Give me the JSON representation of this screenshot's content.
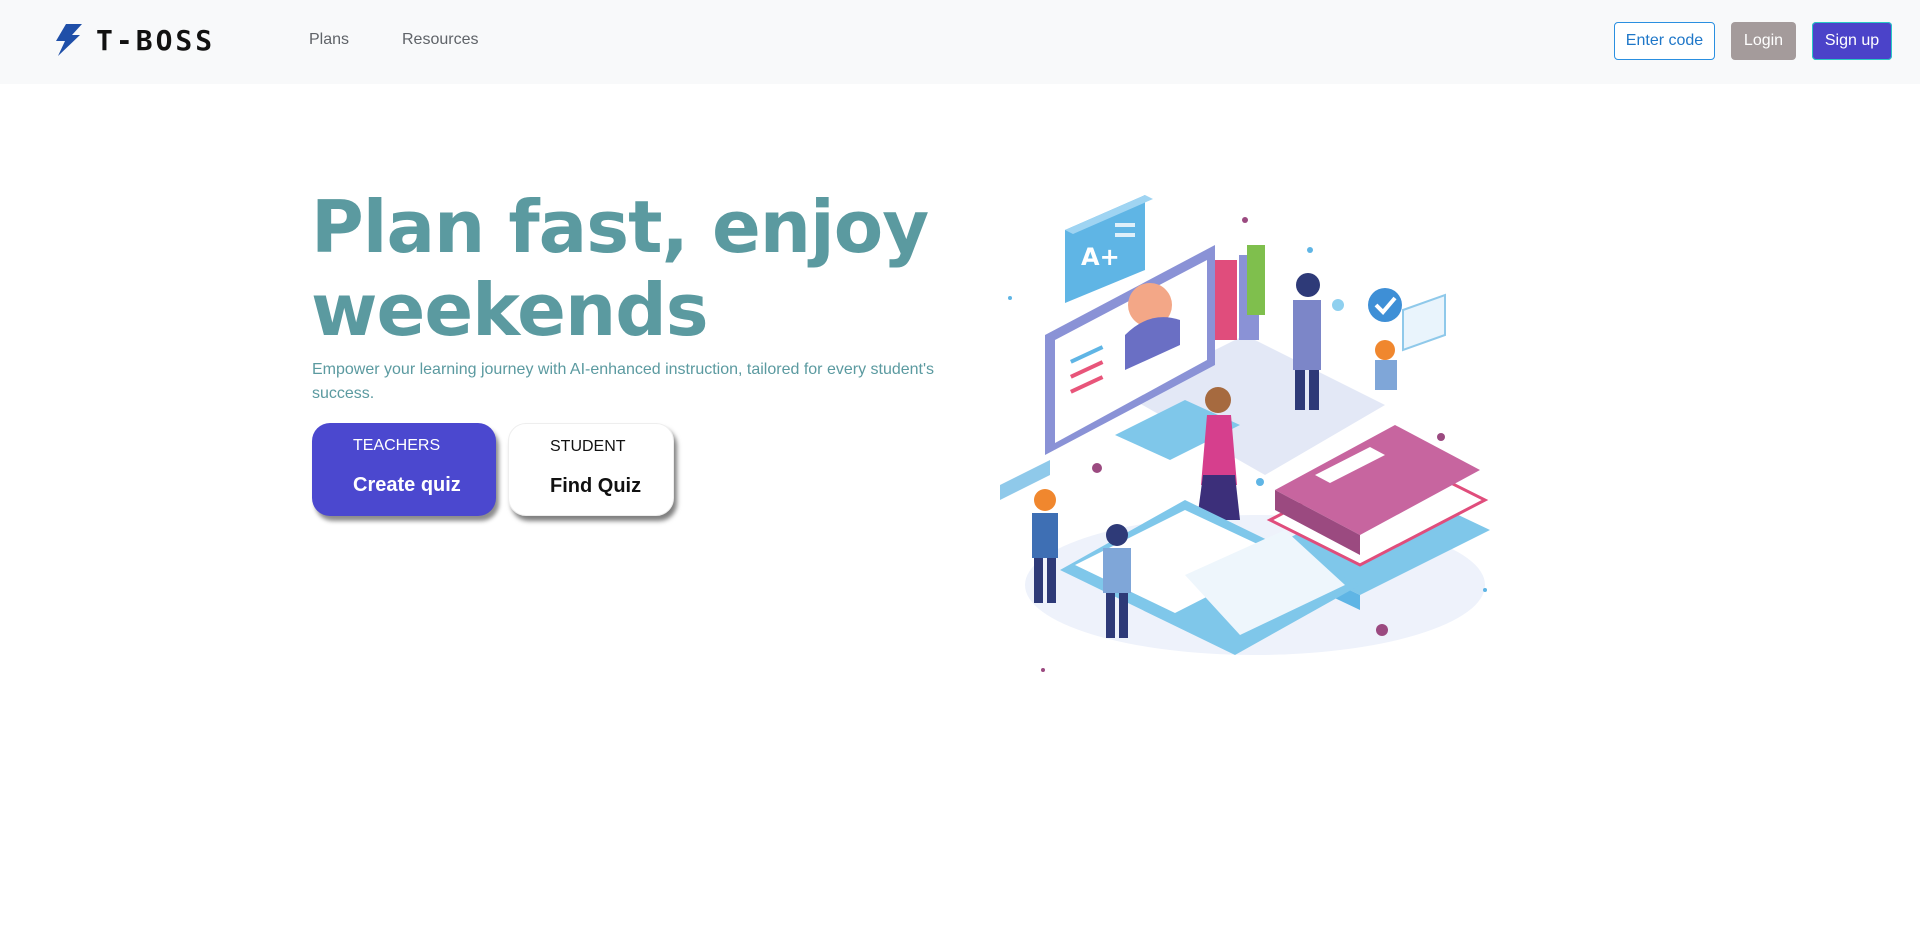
{
  "nav": {
    "brand": "T-BOSS",
    "links": [
      "Plans",
      "Resources"
    ],
    "enter_code": "Enter code",
    "login": "Login",
    "signup": "Sign up"
  },
  "hero": {
    "title": "Plan fast, enjoy weekends",
    "subtitle": "Empower your learning journey with AI-enhanced instruction, tailored for every student's success.",
    "teacher_card": {
      "kicker": "TEACHERS",
      "action": "Create quiz"
    },
    "student_card": {
      "kicker": "STUDENT",
      "action": "Find Quiz"
    },
    "illustration": {
      "badge_text": "A+"
    }
  },
  "colors": {
    "accent": "#4b48cf",
    "headline": "#5b9aa0",
    "outline_button": "#1f77c8",
    "login_button": "#a49b9b"
  },
  "icons": [
    "lightning-bolt-icon",
    "check-icon"
  ]
}
